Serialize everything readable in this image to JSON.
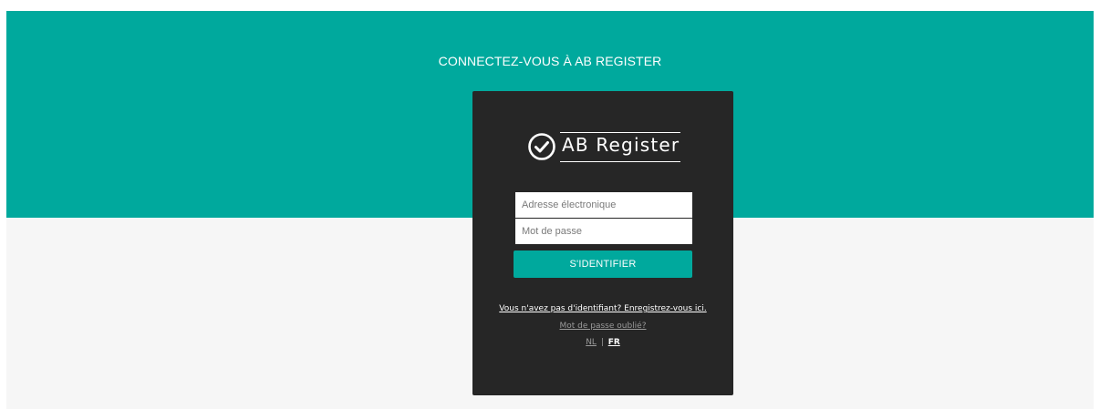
{
  "header": {
    "title": "CONNECTEZ-VOUS À AB REGISTER"
  },
  "logo": {
    "text": "AB Register",
    "icon": "check-circle-icon"
  },
  "form": {
    "email_placeholder": "Adresse électronique",
    "password_placeholder": "Mot de passe",
    "submit_label": "S'IDENTIFIER"
  },
  "links": {
    "register": "Vous n'avez pas d'identifiant? Enregistrez-vous ici.",
    "forgot_password": "Mot de passe oublié?"
  },
  "language": {
    "options": [
      "NL",
      "FR"
    ],
    "separator": "|",
    "selected": "FR"
  },
  "colors": {
    "brand": "#00a99d",
    "card": "#262626",
    "background": "#f6f6f6"
  }
}
